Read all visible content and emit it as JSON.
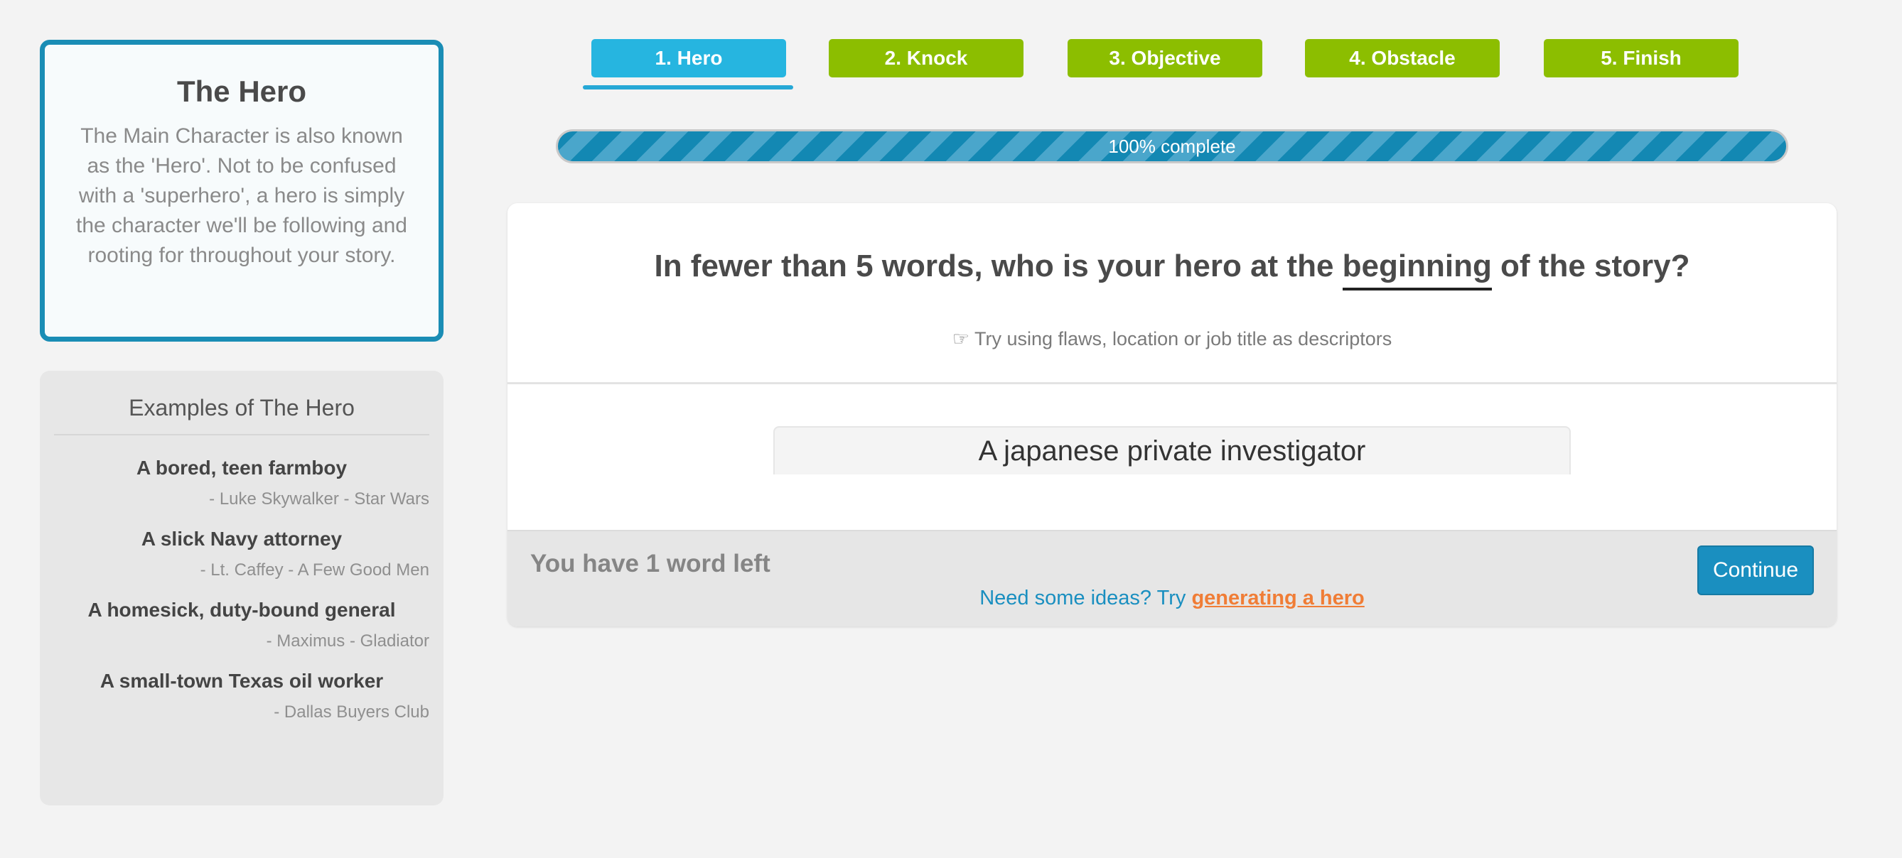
{
  "sidebar": {
    "card": {
      "title": "The Hero",
      "description": "The Main Character is also known as the 'Hero'. Not to be confused with a 'superhero', a hero is simply the character we'll be following and rooting for throughout your story."
    },
    "examples": {
      "heading": "Examples of The Hero",
      "items": [
        {
          "title": "A bored, teen farmboy",
          "source": "- Luke Skywalker - Star Wars"
        },
        {
          "title": "A slick Navy attorney",
          "source": "- Lt. Caffey - A Few Good Men"
        },
        {
          "title": "A homesick, duty-bound general",
          "source": "- Maximus - Gladiator"
        },
        {
          "title": "A small-town Texas oil worker",
          "source": "- Dallas Buyers Club"
        }
      ]
    }
  },
  "tabs": [
    {
      "label": "1. Hero",
      "active": true
    },
    {
      "label": "2. Knock",
      "active": false
    },
    {
      "label": "3. Objective",
      "active": false
    },
    {
      "label": "4. Obstacle",
      "active": false
    },
    {
      "label": "5. Finish",
      "active": false
    }
  ],
  "progress": {
    "value": 1.0,
    "label": "100% complete"
  },
  "main": {
    "question_before": "In fewer than 5 words, who is your hero at the ",
    "question_emphasis": "beginning",
    "question_after": " of the story?",
    "hint_icon": "pointing-hand-icon",
    "hint_icon_glyph": "☞",
    "hint": "Try using flaws, location or job title as descriptors",
    "answer_value": "A japanese private investigator",
    "words_left": "You have 1 word left",
    "continue_label": "Continue",
    "ideas_prefix": "Need some ideas? Try ",
    "ideas_link": "generating a hero"
  },
  "colors": {
    "active_tab": "#26b5e0",
    "inactive_tab": "#8cbe00",
    "accent": "#1a8fc0",
    "link": "#f07d36"
  }
}
